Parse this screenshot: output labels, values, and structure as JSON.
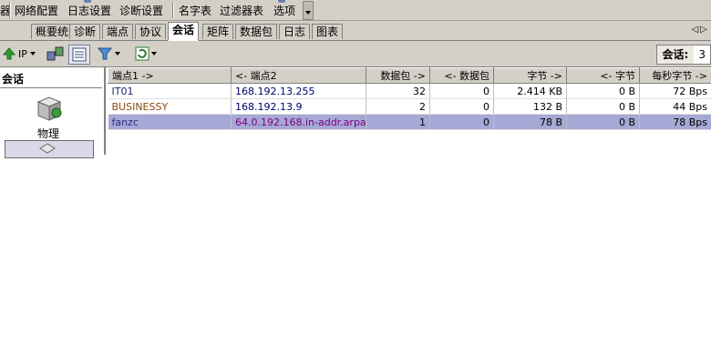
{
  "menu": {
    "items": [
      "器",
      "网络配置",
      "日志设置",
      "诊断设置",
      "名字表",
      "过滤器表",
      "选项"
    ]
  },
  "tabs": {
    "items": [
      "概要统计",
      "诊断",
      "端点",
      "协议",
      "会话",
      "矩阵",
      "数据包",
      "日志",
      "图表"
    ],
    "active_index": 4,
    "scroll_arrows": "◁▷"
  },
  "toolbar": {
    "ip_label": "IP",
    "session_label": "会话:",
    "session_count": "3"
  },
  "left_panel": {
    "title": "会话",
    "physical_label": "物理"
  },
  "table": {
    "columns": [
      "端点1 ->",
      "<- 端点2",
      "数据包 ->",
      "<- 数据包",
      "字节 ->",
      "<- 字节",
      "每秒字节 ->"
    ],
    "rows": [
      {
        "ep1": "IT01",
        "ep2": "168.192.13.255",
        "pkt_out": "32",
        "pkt_in": "0",
        "bytes_out": "2.414 KB",
        "bytes_in": "0 B",
        "bps": "72 Bps"
      },
      {
        "ep1": "BUSINESSY",
        "ep2": "168.192.13.9",
        "pkt_out": "2",
        "pkt_in": "0",
        "bytes_out": "132 B",
        "bytes_in": "0 B",
        "bps": "44 Bps"
      },
      {
        "ep1": "fanzc",
        "ep2": "64.0.192.168.in-addr.arpa",
        "pkt_out": "1",
        "pkt_in": "0",
        "bytes_out": "78 B",
        "bytes_in": "0 B",
        "bps": "78 Bps"
      }
    ],
    "selected_row": 2
  },
  "colors": {
    "chrome": "#d4d0c8",
    "selection": "#a6a9d5",
    "accent": "#6b7fb4"
  }
}
